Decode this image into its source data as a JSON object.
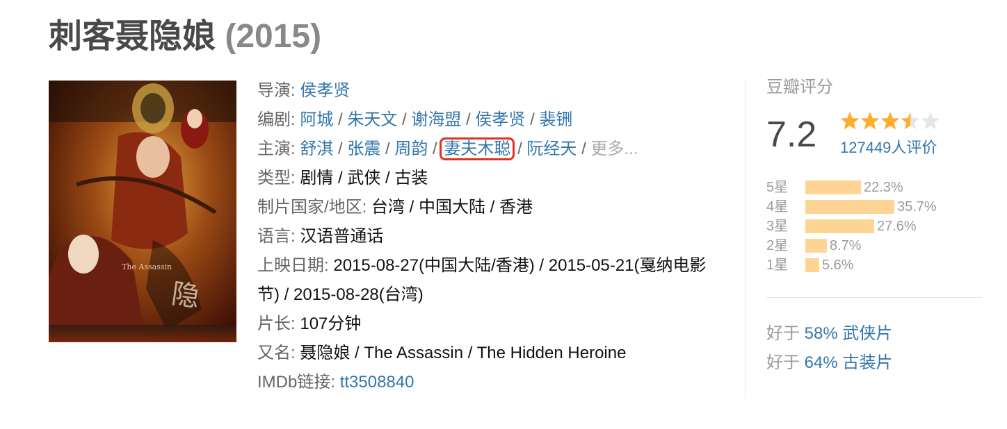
{
  "movie": {
    "title": "刺客聂隐娘",
    "year": "(2015)",
    "poster_alt": "The Assassin poster"
  },
  "info": {
    "director_label": "导演:",
    "director": "侯孝贤",
    "writers_label": "编剧:",
    "writers": [
      "阿城",
      "朱天文",
      "谢海盟",
      "侯孝贤",
      "裴铏"
    ],
    "cast_label": "主演:",
    "cast": [
      "舒淇",
      "张震",
      "周韵",
      "妻夫木聪",
      "阮经天"
    ],
    "cast_more": "更多...",
    "genre_label": "类型:",
    "genres": "剧情 / 武侠 / 古装",
    "country_label": "制片国家/地区:",
    "country": "台湾 / 中国大陆 / 香港",
    "language_label": "语言:",
    "language": "汉语普通话",
    "release_label": "上映日期:",
    "release": "2015-08-27(中国大陆/香港) / 2015-05-21(戛纳电影节) / 2015-08-28(台湾)",
    "runtime_label": "片长:",
    "runtime": "107分钟",
    "aka_label": "又名:",
    "aka": "聂隐娘 / The Assassin / The Hidden Heroine",
    "imdb_label": "IMDb链接:",
    "imdb": "tt3508840"
  },
  "rating": {
    "title": "豆瓣评分",
    "score": "7.2",
    "stars_value": 3.5,
    "stars_max": 5,
    "star_color": "#ffac2d",
    "star_empty_color": "#e6e6e6",
    "votes": "127449人评价",
    "bars": [
      {
        "label": "5星",
        "pct": "22.3%",
        "value": 22.3
      },
      {
        "label": "4星",
        "pct": "35.7%",
        "value": 35.7
      },
      {
        "label": "3星",
        "pct": "27.6%",
        "value": 27.6
      },
      {
        "label": "2星",
        "pct": "8.7%",
        "value": 8.7
      },
      {
        "label": "1星",
        "pct": "5.6%",
        "value": 5.6
      }
    ],
    "bar_color": "#ffd596",
    "better_than": [
      {
        "prefix": "好于",
        "pct": "58%",
        "genre": "武侠片"
      },
      {
        "prefix": "好于",
        "pct": "64%",
        "genre": "古装片"
      }
    ]
  },
  "colors": {
    "link": "#3377aa",
    "highlight_box": "#e0331f",
    "title": "#494949"
  }
}
